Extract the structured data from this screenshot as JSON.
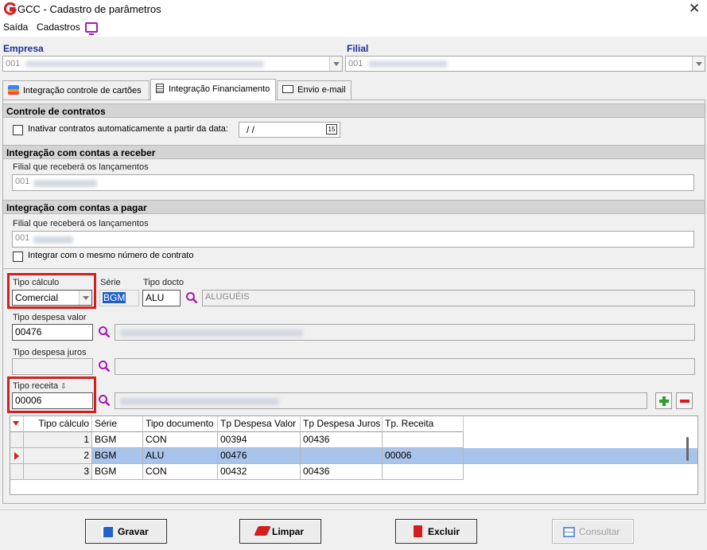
{
  "window": {
    "title": "GCC - Cadastro de parâmetros"
  },
  "menu": {
    "items": [
      "Saída",
      "Cadastros"
    ]
  },
  "header": {
    "empresa_label": "Empresa",
    "empresa_value": "001",
    "filial_label": "Filial",
    "filial_value": "001"
  },
  "tabs": [
    "Integração controle de cartões",
    "Integração Financiamento",
    "Envio e-mail"
  ],
  "controle": {
    "title": "Controle de contratos",
    "check_label": "Inativar contratos automaticamente a partir da data:",
    "date_value": "/ /"
  },
  "receber": {
    "title": "Integração com contas a receber",
    "filial_label": "Filial que receberá os lançamentos",
    "filial_value": "001"
  },
  "pagar": {
    "title": "Integração com contas a pagar",
    "filial_label": "Filial que receberá os lançamentos",
    "filial_value": "001",
    "check_label": "Integrar com o mesmo número de contrato"
  },
  "form": {
    "tipo_calculo_label": "Tipo cálculo",
    "tipo_calculo_value": "Comercial",
    "serie_label": "Série",
    "serie_value": "BGM",
    "tipo_docto_label": "Tipo docto",
    "tipo_docto_value": "ALU",
    "tipo_docto_desc": "ALUGUÉIS",
    "despesa_valor_label": "Tipo despesa valor",
    "despesa_valor_value": "00476",
    "despesa_juros_label": "Tipo despesa juros",
    "despesa_juros_value": "",
    "receita_label": "Tipo receita",
    "receita_value": "00006"
  },
  "grid": {
    "columns": [
      "Tipo cálculo",
      "Série",
      "Tipo documento",
      "Tp Despesa Valor",
      "Tp Despesa Juros",
      "Tp. Receita"
    ],
    "rows": [
      [
        "1",
        "BGM",
        "CON",
        "00394",
        "00436",
        ""
      ],
      [
        "2",
        "BGM",
        "ALU",
        "00476",
        "",
        "00006"
      ],
      [
        "3",
        "BGM",
        "CON",
        "00432",
        "00436",
        ""
      ]
    ]
  },
  "buttons": {
    "gravar": "Gravar",
    "limpar": "Limpar",
    "excluir": "Excluir",
    "consultar": "Consultar"
  },
  "colors": {
    "header_blue": "#1e2f97",
    "highlight_red": "#d41f1f",
    "selected_row": "#a9c4ea",
    "accent_purple": "#a21caf"
  }
}
